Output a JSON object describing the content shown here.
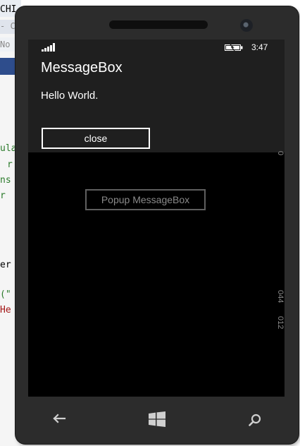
{
  "ide_fragments": [
    {
      "text": "CHI",
      "color": "#000000"
    },
    {
      "text": "- CP",
      "color": "#888888"
    },
    {
      "text": "No",
      "color": "#888888"
    },
    {
      "text": "ula",
      "color": "#2a7a2a"
    },
    {
      "text": "r",
      "color": "#2a7a2a"
    },
    {
      "text": "ns",
      "color": "#2a7a2a"
    },
    {
      "text": "r",
      "color": "#2a7a2a"
    },
    {
      "text": "er",
      "color": "#000000"
    },
    {
      "text": "(\"",
      "color": "#2a7a2a"
    },
    {
      "text": "He",
      "color": "#a31515"
    }
  ],
  "status_bar": {
    "time": "3:47"
  },
  "message_box": {
    "title": "MessageBox",
    "text": "Hello World.",
    "close_label": "close"
  },
  "app": {
    "popup_button_label": "Popup MessageBox"
  },
  "frame_counters": [
    "044",
    "012"
  ],
  "nav": {
    "back_icon": "back-arrow-icon",
    "start_icon": "windows-logo-icon",
    "search_icon": "search-icon"
  },
  "colors": {
    "phone_body": "#2c2c2c",
    "msgbox_bg": "#1f1f1f",
    "screen_bg": "#000000",
    "accent_ide_blue": "#2e4d8c"
  }
}
